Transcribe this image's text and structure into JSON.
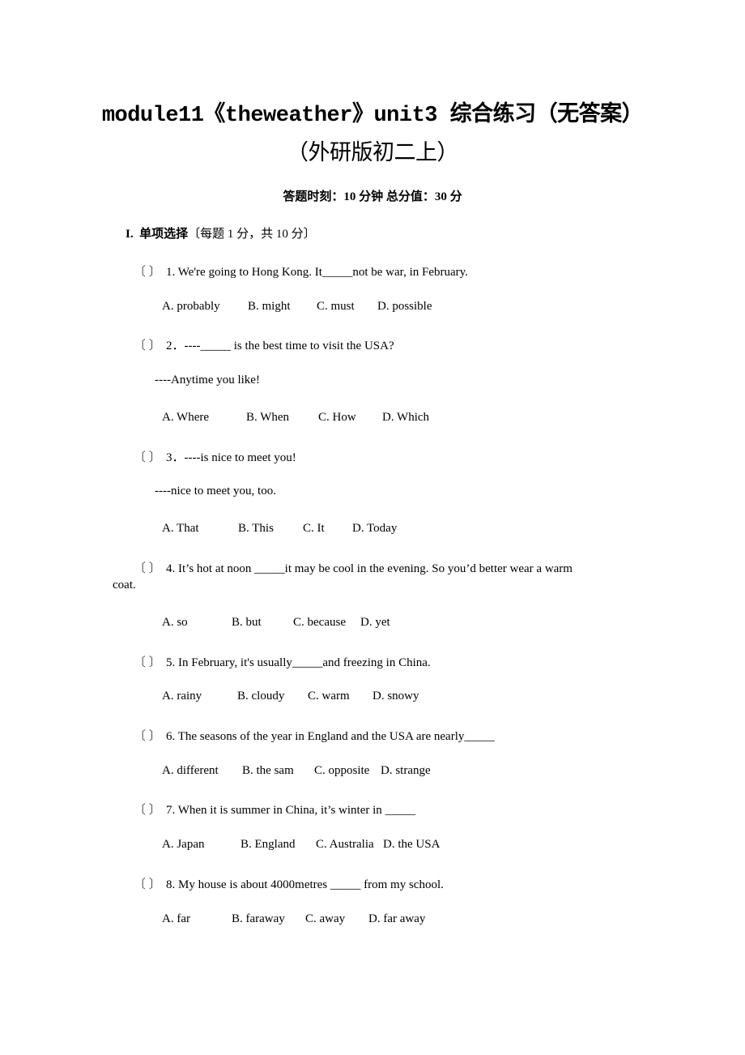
{
  "document": {
    "title_line1": "module11《theweather》unit3 综合练习（无答案）",
    "title_line2": "（外研版初二上）",
    "meta": "答题时刻：10 分钟   总分值：30 分",
    "section": {
      "number": "I.",
      "name": "单项选择",
      "note": "〔每题 1 分，共 10 分〕"
    },
    "paren": "〔   〕",
    "questions": [
      {
        "stem": "1. We're going to Hong Kong. It_____not be war, in February.",
        "options": [
          "A. probably",
          "B. might",
          "C. must",
          "D. possible"
        ]
      },
      {
        "stem": "2．----_____ is the best time to visit the USA?",
        "reply": "----Anytime you like!",
        "options": [
          "A. Where",
          "B. When",
          "C. How",
          "D. Which"
        ]
      },
      {
        "stem": "3．----is nice to meet you!",
        "reply": "----nice to meet you, too.",
        "options": [
          "A. That",
          "B. This",
          "C. It",
          "D. Today"
        ]
      },
      {
        "stem": "4. It’s hot at noon _____it may be cool in the evening. So you’d better wear a warm",
        "stem_cont": "coat.",
        "options": [
          "A. so",
          "B. but",
          "C. because",
          "D. yet"
        ]
      },
      {
        "stem": "5. In February, it's usually_____and freezing in China.",
        "options": [
          "A. rainy",
          "B. cloudy",
          "C. warm",
          "D. snowy"
        ]
      },
      {
        "stem": "6. The seasons of the year in England and the USA are nearly_____",
        "options": [
          "A. different",
          "B. the sam",
          "C. opposite",
          "D. strange"
        ]
      },
      {
        "stem": "7. When it is summer in China, it’s winter in _____",
        "options": [
          "A. Japan",
          "B. England",
          "C. Australia",
          "D. the USA"
        ]
      },
      {
        "stem": "8. My house is about 4000metres _____ from my school.",
        "options": [
          "A. far",
          "B. faraway",
          "C. away",
          "D. far away"
        ]
      }
    ]
  }
}
